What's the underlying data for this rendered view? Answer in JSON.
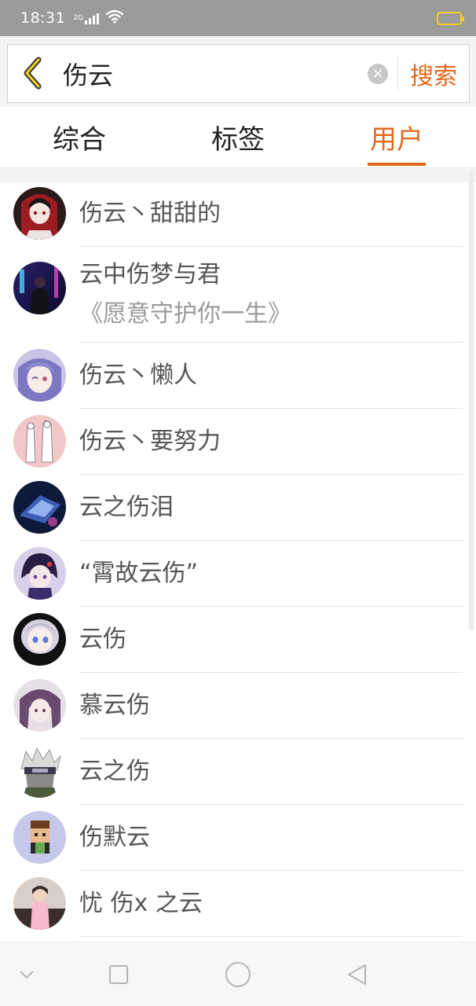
{
  "status_bar": {
    "time": "18:31",
    "network": "2G",
    "battery_color": "#f2d21a"
  },
  "search": {
    "query": "伤云",
    "search_button": "搜索",
    "clear_glyph": "×"
  },
  "tabs": [
    {
      "label": "综合",
      "active": false
    },
    {
      "label": "标签",
      "active": false
    },
    {
      "label": "用户",
      "active": true
    }
  ],
  "users": [
    {
      "name": "伤云丶甜甜的",
      "avatar_icon": "anime-girl-red-hood-avatar"
    },
    {
      "name": "云中伤梦与君",
      "subtitle": "《愿意守护你一生》",
      "avatar_icon": "neon-city-figure-avatar"
    },
    {
      "name": "伤云丶懒人",
      "avatar_icon": "anime-girl-wink-avatar"
    },
    {
      "name": "伤云丶要努力",
      "avatar_icon": "sketch-couple-avatar"
    },
    {
      "name": "云之伤泪",
      "avatar_icon": "dark-blue-abstract-avatar"
    },
    {
      "name": "“霄故云伤”",
      "avatar_icon": "anime-boy-purple-avatar"
    },
    {
      "name": "云伤",
      "avatar_icon": "anime-silver-hair-avatar"
    },
    {
      "name": "慕云伤",
      "avatar_icon": "anime-purple-hair-girl-avatar"
    },
    {
      "name": "云之伤",
      "avatar_icon": "masked-ninja-avatar"
    },
    {
      "name": "伤默云",
      "avatar_icon": "pixel-character-avatar"
    },
    {
      "name": "忧 伤x 之云",
      "avatar_icon": "child-photo-avatar"
    }
  ],
  "colors": {
    "accent": "#e2681e",
    "status_bar_bg": "#9b9b9b"
  }
}
